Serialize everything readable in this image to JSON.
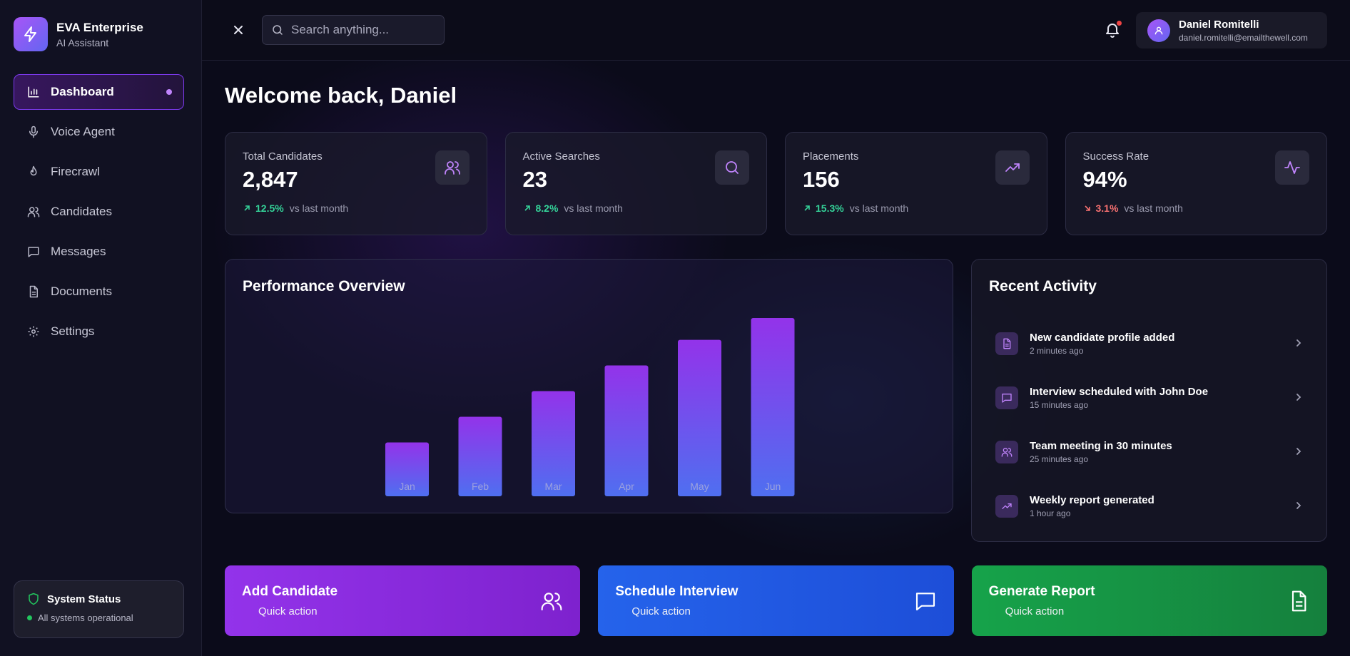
{
  "brand": {
    "name": "EVA Enterprise",
    "subtitle": "AI Assistant"
  },
  "sidebar": {
    "items": [
      {
        "label": "Dashboard",
        "icon": "bar-chart-icon",
        "active": true
      },
      {
        "label": "Voice Agent",
        "icon": "microphone-icon",
        "active": false
      },
      {
        "label": "Firecrawl",
        "icon": "flame-icon",
        "active": false
      },
      {
        "label": "Candidates",
        "icon": "users-icon",
        "active": false
      },
      {
        "label": "Messages",
        "icon": "message-icon",
        "active": false
      },
      {
        "label": "Documents",
        "icon": "document-icon",
        "active": false
      },
      {
        "label": "Settings",
        "icon": "gear-icon",
        "active": false
      }
    ],
    "status": {
      "title": "System Status",
      "text": "All systems operational"
    }
  },
  "topbar": {
    "search_placeholder": "Search anything...",
    "user": {
      "name": "Daniel Romitelli",
      "email": "daniel.romitelli@emailthewell.com"
    }
  },
  "main": {
    "welcome": "Welcome back, Daniel",
    "stats": [
      {
        "label": "Total Candidates",
        "value": "2,847",
        "change": "12.5%",
        "direction": "up",
        "compare": "vs last month",
        "icon": "users-icon"
      },
      {
        "label": "Active Searches",
        "value": "23",
        "change": "8.2%",
        "direction": "up",
        "compare": "vs last month",
        "icon": "search-icon"
      },
      {
        "label": "Placements",
        "value": "156",
        "change": "15.3%",
        "direction": "up",
        "compare": "vs last month",
        "icon": "trending-up-icon"
      },
      {
        "label": "Success Rate",
        "value": "94%",
        "change": "3.1%",
        "direction": "down",
        "compare": "vs last month",
        "icon": "activity-icon"
      }
    ],
    "performance": {
      "title": "Performance Overview"
    },
    "activity": {
      "title": "Recent Activity",
      "items": [
        {
          "title": "New candidate profile added",
          "time": "2 minutes ago",
          "icon": "document-icon"
        },
        {
          "title": "Interview scheduled with John Doe",
          "time": "15 minutes ago",
          "icon": "message-icon"
        },
        {
          "title": "Team meeting in 30 minutes",
          "time": "25 minutes ago",
          "icon": "users-icon"
        },
        {
          "title": "Weekly report generated",
          "time": "1 hour ago",
          "icon": "trending-up-icon"
        }
      ]
    },
    "quick_actions": [
      {
        "title": "Add Candidate",
        "subtitle": "Quick action",
        "icon": "users-icon",
        "color": "#9333ea"
      },
      {
        "title": "Schedule Interview",
        "subtitle": "Quick action",
        "icon": "message-icon",
        "color": "#2563eb"
      },
      {
        "title": "Generate Report",
        "subtitle": "Quick action",
        "icon": "document-icon",
        "color": "#16a34a"
      }
    ]
  },
  "chart_data": {
    "type": "bar",
    "categories": [
      "Jan",
      "Feb",
      "Mar",
      "Apr",
      "May",
      "Jun"
    ],
    "values": [
      42,
      62,
      82,
      102,
      122,
      139
    ],
    "title": "Performance Overview",
    "xlabel": "",
    "ylabel": "",
    "ylim": [
      0,
      139
    ],
    "grid": false,
    "colors": {
      "top": "#9333ea",
      "bottom": "#4f6ff0"
    }
  }
}
